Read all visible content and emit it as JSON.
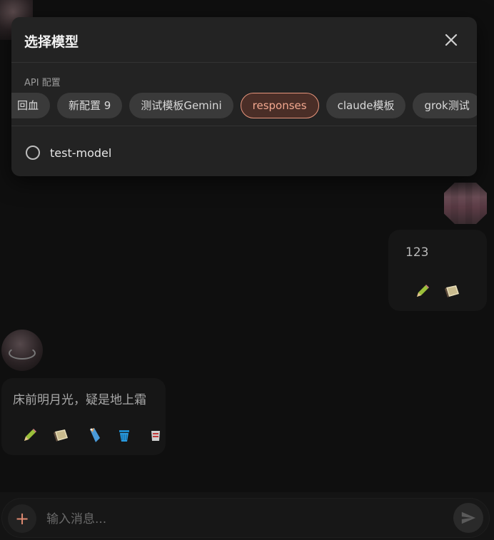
{
  "modal": {
    "title": "选择模型",
    "section_label": "API 配置",
    "configs": [
      {
        "label": "回血",
        "active": false
      },
      {
        "label": "新配置 9",
        "active": false
      },
      {
        "label": "测试模板Gemini",
        "active": false
      },
      {
        "label": "responses",
        "active": true
      },
      {
        "label": "claude模板",
        "active": false
      },
      {
        "label": "grok测试",
        "active": false
      }
    ],
    "models": [
      {
        "label": "test-model",
        "selected": false
      }
    ]
  },
  "chat": {
    "user_message": "123",
    "bot_message": "床前明月光，疑是地上霜",
    "user_actions": [
      "edit-icon",
      "copy-icon"
    ],
    "bot_actions": [
      "edit-icon",
      "copy-icon",
      "tag-icon",
      "trash-icon",
      "regenerate-icon"
    ]
  },
  "composer": {
    "placeholder": "输入消息...",
    "plus_label": "+"
  },
  "colors": {
    "accent": "#e8957c",
    "background": "#0f0f0f",
    "modal": "#232323"
  }
}
